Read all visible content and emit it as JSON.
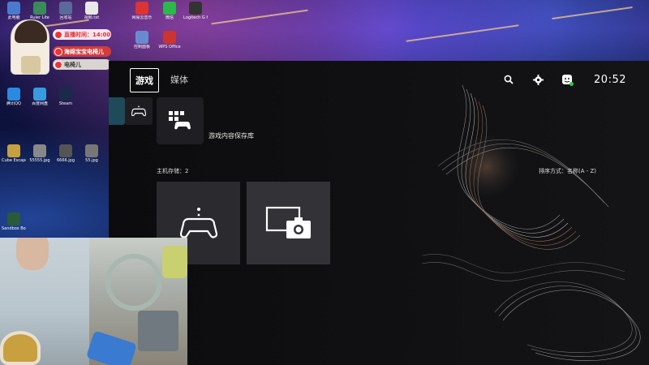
{
  "overlay": {
    "play_time_label": "直播时间：14:00",
    "badge_label": "海绵宝宝电椅儿",
    "name_label": "电椅儿"
  },
  "desktop_icons": [
    {
      "label": "此电脑"
    },
    {
      "label": "Ruler Lite"
    },
    {
      "label": "回收站"
    },
    {
      "label": "视频.txt"
    },
    {
      "label": "网易云音乐"
    },
    {
      "label": "微信"
    },
    {
      "label": "Logitech G HUB"
    },
    {
      "label": "控制面板"
    },
    {
      "label": "WPS Office"
    },
    {
      "label": "腾讯QQ"
    },
    {
      "label": "百度网盘"
    },
    {
      "label": "Steam"
    },
    {
      "label": "Cube Escape"
    },
    {
      "label": "55555.jpg"
    },
    {
      "label": "6666.jpg"
    },
    {
      "label": "55.jpg"
    },
    {
      "label": "Sandbox Boom"
    }
  ],
  "ps": {
    "tabs": [
      {
        "label": "游戏",
        "active": true
      },
      {
        "label": "媒体",
        "active": false
      }
    ],
    "clock": "20:52",
    "library": {
      "label": "游戏内容保存库"
    },
    "section_label": "主机存储：2",
    "sort_label": "排序方式：名称(A - Z)",
    "tiles": [
      {
        "icon": "gamepad-icon"
      },
      {
        "icon": "screenshot-camera-icon"
      }
    ]
  },
  "colors": {
    "ps_bg": "#0c0c0e",
    "tile_bg": "#2b2b2f",
    "active_side": "#1e4a5a",
    "status_green": "#2ecc40"
  }
}
